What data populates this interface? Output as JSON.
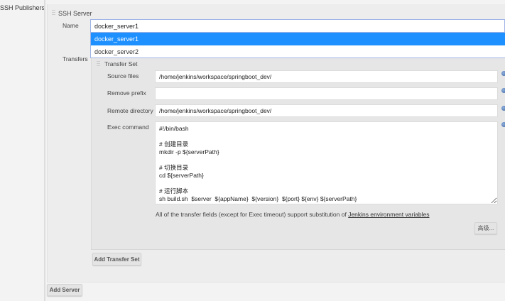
{
  "section_label": "SSH Publishers",
  "server": {
    "title": "SSH Server",
    "name_label": "Name",
    "name_value": "docker_server1",
    "dropdown_options": [
      "docker_server1",
      "docker_server2"
    ],
    "transfers_label": "Transfers",
    "transfer_set": {
      "title": "Transfer Set",
      "source_files_label": "Source files",
      "source_files_value": "/home/jenkins/workspace/springboot_dev/",
      "remove_prefix_label": "Remove prefix",
      "remove_prefix_value": "",
      "remote_directory_label": "Remote directory",
      "remote_directory_value": "/home/jenkins/workspace/springboot_dev/",
      "exec_command_label": "Exec command",
      "exec_command_value": "#!/bin/bash\n\n# 创建目录\nmkdir -p ${serverPath}\n\n# 切换目录\ncd ${serverPath}\n\n# 运行脚本\nsh build.sh  $server  ${appName}  ${version}  ${port} ${env} ${serverPath}",
      "note_text": "All of the transfer fields (except for Exec timeout) support substitution of ",
      "note_link": "Jenkins environment variables",
      "advanced_button": "高级..."
    },
    "add_transfer_set_button": "Add Transfer Set"
  },
  "add_server_button": "Add Server",
  "colors": {
    "selected_option": "#1e90ff",
    "panel": "#ededed",
    "transfer_panel": "#e6e6e6"
  }
}
